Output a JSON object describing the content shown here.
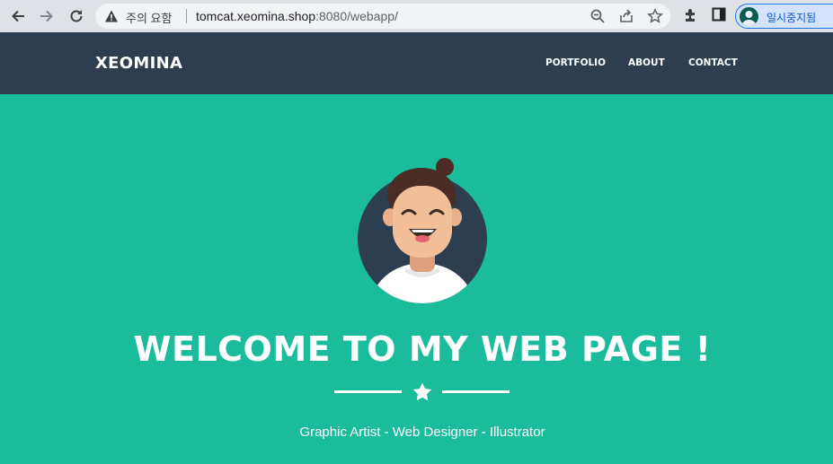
{
  "browser": {
    "security_warning": "주의 요함",
    "url_host": "tomcat.xeomina.shop",
    "url_rest": ":8080/webapp/",
    "profile_label": "일시중지됨",
    "icons": [
      "back-arrow-icon",
      "forward-arrow-icon",
      "reload-icon",
      "warning-icon",
      "zoom-icon",
      "share-icon",
      "star-bookmark-icon",
      "extensions-icon",
      "side-panel-icon",
      "profile-icon"
    ]
  },
  "navbar": {
    "brand": "XEOMINA",
    "links": [
      "PORTFOLIO",
      "ABOUT",
      "CONTACT"
    ]
  },
  "hero": {
    "title": "WELCOME TO MY WEB PAGE !",
    "subtitle": "Graphic Artist - Web Designer - Illustrator"
  },
  "colors": {
    "navbar_bg": "#2c3e50",
    "hero_bg": "#1abc9c",
    "text": "#ffffff"
  }
}
